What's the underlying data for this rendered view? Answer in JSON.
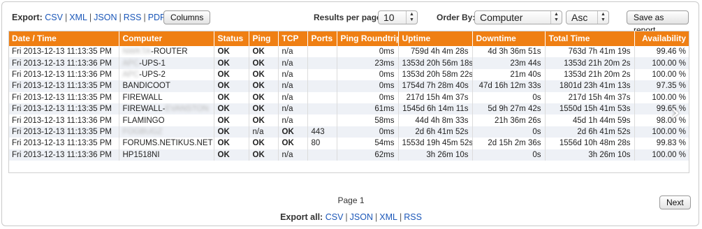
{
  "toolbar": {
    "export_label": "Export:",
    "export_links": [
      "CSV",
      "XML",
      "JSON",
      "RSS",
      "PDF"
    ],
    "columns_button": "Columns",
    "results_per_page_label": "Results per page:",
    "results_per_page_value": "10",
    "order_by_label": "Order By:",
    "order_by_value": "Computer",
    "order_direction_value": "Asc",
    "save_report_button": "Save as report"
  },
  "table": {
    "columns": [
      "Date / Time",
      "Computer",
      "Status",
      "Ping",
      "TCP",
      "Ports",
      "Ping Roundtrip",
      "Uptime",
      "Downtime",
      "Total Time",
      "Availability"
    ],
    "rows": [
      {
        "datetime": "Fri 2013-12-13 11:13:35 PM",
        "computer_blur": "NWKTA",
        "computer": "-ROUTER",
        "status": "OK",
        "ping": "OK",
        "tcp": "n/a",
        "ports": "",
        "roundtrip": "0ms",
        "uptime": "759d 4h 4m 28s",
        "downtime": "4d 3h 36m 51s",
        "total": "763d 7h 41m 19s",
        "availability": "99.46 %",
        "avail_color": "green"
      },
      {
        "datetime": "Fri 2013-12-13 11:13:36 PM",
        "computer_blur": "APC",
        "computer": "-UPS-1",
        "status": "OK",
        "ping": "OK",
        "tcp": "n/a",
        "ports": "",
        "roundtrip": "23ms",
        "uptime": "1353d 20h 56m 18s",
        "downtime": "23m 44s",
        "total": "1353d 21h 20m 2s",
        "availability": "100.00 %",
        "avail_color": "green"
      },
      {
        "datetime": "Fri 2013-12-13 11:13:36 PM",
        "computer_blur": "APC",
        "computer": "-UPS-2",
        "status": "OK",
        "ping": "OK",
        "tcp": "n/a",
        "ports": "",
        "roundtrip": "0ms",
        "uptime": "1353d 20h 58m 22s",
        "downtime": "21m 40s",
        "total": "1353d 21h 20m 2s",
        "availability": "100.00 %",
        "avail_color": "green"
      },
      {
        "datetime": "Fri 2013-12-13 11:13:35 PM",
        "computer_blur": "",
        "computer": "BANDICOOT",
        "status": "OK",
        "ping": "OK",
        "tcp": "n/a",
        "ports": "",
        "roundtrip": "0ms",
        "uptime": "1754d 7h 28m 40s",
        "downtime": "47d 16h 12m 33s",
        "total": "1801d 23h 41m 13s",
        "availability": "97.35 %",
        "avail_color": "orange"
      },
      {
        "datetime": "Fri 2013-12-13 11:13:35 PM",
        "computer_blur": "",
        "computer": "FIREWALL",
        "status": "OK",
        "ping": "OK",
        "tcp": "n/a",
        "ports": "",
        "roundtrip": "0ms",
        "uptime": "217d 15h 4m 37s",
        "downtime": "0s",
        "total": "217d 15h 4m 37s",
        "availability": "100.00 %",
        "avail_color": "green"
      },
      {
        "datetime": "Fri 2013-12-13 11:13:35 PM",
        "computer_blur": "",
        "computer": "FIREWALL-",
        "computer_suffix_blur": "EVANSTON",
        "status": "OK",
        "ping": "OK",
        "tcp": "n/a",
        "ports": "",
        "roundtrip": "61ms",
        "uptime": "1545d 6h 14m 11s",
        "downtime": "5d 9h 27m 42s",
        "total": "1550d 15h 41m 53s",
        "availability": "99.65 %",
        "avail_color": "green"
      },
      {
        "datetime": "Fri 2013-12-13 11:13:36 PM",
        "computer_blur": "",
        "computer": "FLAMINGO",
        "status": "OK",
        "ping": "OK",
        "tcp": "n/a",
        "ports": "",
        "roundtrip": "58ms",
        "uptime": "44d 4h 8m 33s",
        "downtime": "21h 36m 26s",
        "total": "45d 1h 44m 59s",
        "availability": "98.00 %",
        "avail_color": "orange"
      },
      {
        "datetime": "Fri 2013-12-13 11:13:35 PM",
        "computer_blur": "FOGBUGZ",
        "computer": "",
        "status": "OK",
        "ping": "n/a",
        "tcp": "OK",
        "ports": "443",
        "roundtrip": "0ms",
        "uptime": "2d 6h 41m 52s",
        "downtime": "0s",
        "total": "2d 6h 41m 52s",
        "availability": "100.00 %",
        "avail_color": "green"
      },
      {
        "datetime": "Fri 2013-12-13 11:13:35 PM",
        "computer_blur": "",
        "computer": "FORUMS.NETIKUS.NET",
        "status": "OK",
        "ping": "OK",
        "tcp": "OK",
        "ports": "80",
        "roundtrip": "54ms",
        "uptime": "1553d 19h 45m 52s",
        "downtime": "2d 15h 2m 36s",
        "total": "1556d 10h 48m 28s",
        "availability": "99.83 %",
        "avail_color": "green"
      },
      {
        "datetime": "Fri 2013-12-13 11:13:36 PM",
        "computer_blur": "",
        "computer": "HP1518NI",
        "status": "OK",
        "ping": "OK",
        "tcp": "n/a",
        "ports": "",
        "roundtrip": "62ms",
        "uptime": "3h 26m 10s",
        "downtime": "0s",
        "total": "3h 26m 10s",
        "availability": "100.00 %",
        "avail_color": "green"
      }
    ]
  },
  "pagination": {
    "page_label": "Page 1",
    "next_button": "Next",
    "next_arrow_icon": "chevron-right-icon"
  },
  "footer": {
    "export_all_label": "Export all:",
    "export_all_links": [
      "CSV",
      "JSON",
      "XML",
      "RSS"
    ]
  },
  "colors": {
    "header_orange": "#ef7f13",
    "ok_green": "#1f9a1f",
    "warn_orange": "#e88e00",
    "link_blue": "#1a56b8"
  }
}
